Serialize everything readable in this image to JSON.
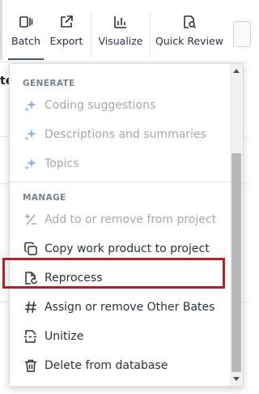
{
  "toolbar": {
    "batch_label": "Batch",
    "export_label": "Export",
    "visualize_label": "Visualize",
    "quick_review_label": "Quick Review"
  },
  "background": {
    "partial_text": "te"
  },
  "menu": {
    "generate_header": "GENERATE",
    "generate_items": [
      {
        "label": "Coding suggestions",
        "icon": "sparkle-icon",
        "enabled": false
      },
      {
        "label": "Descriptions and summaries",
        "icon": "sparkle-icon",
        "enabled": false
      },
      {
        "label": "Topics",
        "icon": "sparkle-icon",
        "enabled": false
      }
    ],
    "manage_header": "MANAGE",
    "manage_items": [
      {
        "label": "Add to or remove from project",
        "icon": "plus-minus-icon",
        "enabled": false
      },
      {
        "label": "Copy work product to project",
        "icon": "copy-icon",
        "enabled": true
      },
      {
        "label": "Reprocess",
        "icon": "reprocess-icon",
        "enabled": true,
        "highlighted": true
      },
      {
        "label": "Assign or remove Other Bates",
        "icon": "hash-icon",
        "enabled": true
      },
      {
        "label": "Unitize",
        "icon": "unitize-icon",
        "enabled": true
      },
      {
        "label": "Delete from database",
        "icon": "trash-icon",
        "enabled": true
      }
    ]
  },
  "colors": {
    "highlight_border": "#b3202a",
    "disabled_text": "#a2a8b0",
    "enabled_text": "#2a323b",
    "header_text": "#7a828c"
  }
}
